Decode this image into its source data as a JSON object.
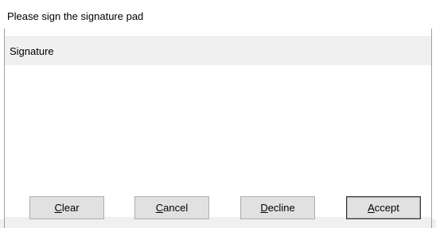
{
  "window": {
    "title": "Please sign the signature pad"
  },
  "signature": {
    "label": "Signature"
  },
  "buttons": {
    "clear": {
      "mnemonic": "C",
      "rest": "lear"
    },
    "cancel": {
      "mnemonic": "C",
      "rest": "ancel"
    },
    "decline": {
      "mnemonic": "D",
      "rest": "ecline"
    },
    "accept": {
      "mnemonic": "A",
      "rest": "ccept"
    }
  },
  "colors": {
    "panel": "#f0f0f0",
    "button_face": "#e1e1e1",
    "button_border": "#adadad",
    "frame_border": "#a0a0a0"
  }
}
